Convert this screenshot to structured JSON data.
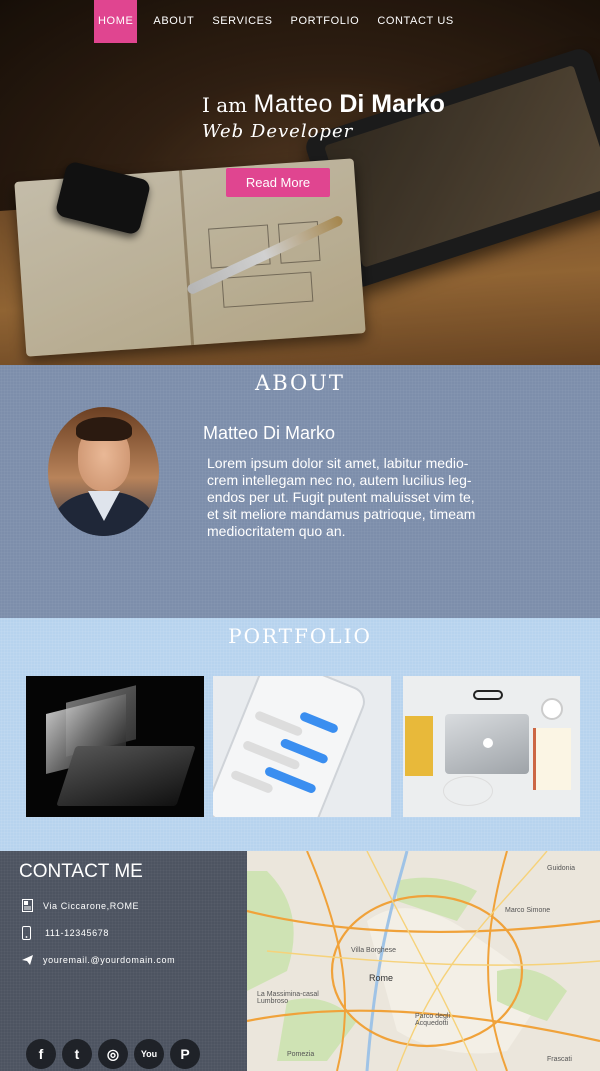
{
  "nav": {
    "items": [
      {
        "label": "HOME",
        "active": true
      },
      {
        "label": "ABOUT",
        "active": false
      },
      {
        "label": "SERVICES",
        "active": false
      },
      {
        "label": "PORTFOLIO",
        "active": false
      },
      {
        "label": "CONTACT US",
        "active": false
      }
    ]
  },
  "hero": {
    "prefix": "I am",
    "first_name": "Matteo",
    "last_name": "Di Marko",
    "role": "Web Developer",
    "cta_label": "Read More"
  },
  "about": {
    "heading": "ABOUT",
    "name": "Matteo Di Marko",
    "text": "Lorem ipsum dolor sit amet, labitur medio-crem intellegam nec no, autem lucilius leg-endos per ut. Fugit putent maluisset vim te, et sit meliore mandamus patrioque, timeam mediocritatem quo an."
  },
  "portfolio": {
    "heading": "PORTFOLIO",
    "items": [
      {
        "subject": "laptop-dark"
      },
      {
        "subject": "smartphone-messages"
      },
      {
        "subject": "macbook-desk"
      }
    ]
  },
  "contact": {
    "heading": "CONTACT ME",
    "address": "Via Ciccarone,ROME",
    "phone": "111-12345678",
    "email": "youremail.@yourdomain.com",
    "social": [
      {
        "icon": "facebook-icon",
        "glyph": "f"
      },
      {
        "icon": "twitter-icon",
        "glyph": "t"
      },
      {
        "icon": "instagram-icon",
        "glyph": "◎"
      },
      {
        "icon": "youtube-icon",
        "glyph": "You"
      },
      {
        "icon": "pinterest-icon",
        "glyph": "P"
      }
    ]
  },
  "map": {
    "labels": [
      "Guidonia",
      "Rome",
      "La Massimina-casal Lumbroso",
      "Frascati",
      "Marco Simone",
      "Villa Borghese",
      "Parco degli Acquedotti",
      "Pomezia"
    ]
  },
  "colors": {
    "accent": "#e04590",
    "about_bg": "#7d8eab",
    "portfolio_bg": "#b7d3ee",
    "contact_bg": "#4d5461"
  }
}
